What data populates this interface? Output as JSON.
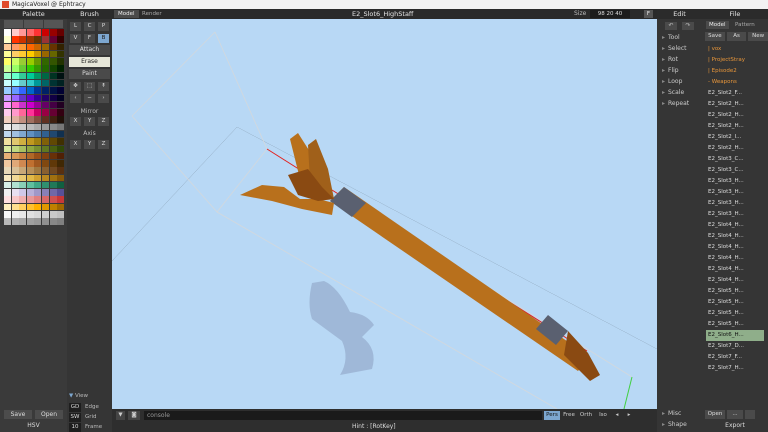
{
  "window": {
    "title": "MagicaVoxel @ Ephtracy"
  },
  "palette": {
    "title": "Palette",
    "tabs": [
      "",
      "",
      ""
    ],
    "colors": [
      "#ffffff",
      "#ffcccc",
      "#ff9999",
      "#ff6666",
      "#ff3333",
      "#cc0000",
      "#990000",
      "#660000",
      "#ffffcc",
      "#ff3300",
      "#cc3300",
      "#993300",
      "#663300",
      "#993333",
      "#660033",
      "#330000",
      "#ffcc99",
      "#ff9966",
      "#ff9933",
      "#ff6600",
      "#cc6600",
      "#996600",
      "#663300",
      "#332200",
      "#ffff99",
      "#ffcc66",
      "#ffcc33",
      "#ffcc00",
      "#cc9900",
      "#996600",
      "#666600",
      "#333300",
      "#ffff66",
      "#ccff66",
      "#99cc33",
      "#99cc00",
      "#669900",
      "#336600",
      "#335500",
      "#223300",
      "#ccff99",
      "#99ff66",
      "#66cc33",
      "#33cc00",
      "#339900",
      "#226600",
      "#114400",
      "#002200",
      "#99ffcc",
      "#66ffcc",
      "#33cc99",
      "#00cc99",
      "#009966",
      "#006644",
      "#003322",
      "#001111",
      "#ccffff",
      "#99ffff",
      "#66cccc",
      "#33cccc",
      "#009999",
      "#006666",
      "#003333",
      "#002222",
      "#99ccff",
      "#6699ff",
      "#3366ff",
      "#0066cc",
      "#003399",
      "#002266",
      "#001144",
      "#000033",
      "#cc99ff",
      "#9966ff",
      "#6633cc",
      "#6600cc",
      "#330099",
      "#220066",
      "#110044",
      "#000022",
      "#ff99ff",
      "#ff66cc",
      "#cc33cc",
      "#cc00cc",
      "#990099",
      "#660066",
      "#440044",
      "#220022",
      "#ffccee",
      "#ff99cc",
      "#ff6699",
      "#ff3399",
      "#cc0066",
      "#990044",
      "#660033",
      "#330011",
      "#f0d0c0",
      "#e0b0a0",
      "#c09080",
      "#a07060",
      "#805040",
      "#603020",
      "#402010",
      "#201008",
      "#eeeeee",
      "#dddddd",
      "#cccccc",
      "#bbbbbb",
      "#aaaaaa",
      "#999999",
      "#888888",
      "#777777",
      "#c0d8f0",
      "#a0c0e0",
      "#80a8d0",
      "#6090c0",
      "#4878a8",
      "#306090",
      "#204870",
      "#103050",
      "#f0e0a0",
      "#e0c870",
      "#d0b040",
      "#c09820",
      "#a08010",
      "#806008",
      "#604804",
      "#403002",
      "#d8e8a0",
      "#c0d880",
      "#a8c060",
      "#90a840",
      "#789030",
      "#607820",
      "#486010",
      "#304808",
      "#e8b078",
      "#d89858",
      "#c88040",
      "#b06828",
      "#985018",
      "#804010",
      "#683008",
      "#502004",
      "#f0c8a0",
      "#e0a878",
      "#d08850",
      "#c07030",
      "#a05820",
      "#804810",
      "#603808",
      "#402804",
      "#e8d8b8",
      "#d8c098",
      "#c8a878",
      "#b89058",
      "#a07840",
      "#886030",
      "#704820",
      "#583010",
      "#f8e8c0",
      "#f0d898",
      "#e8c870",
      "#e0b848",
      "#d0a030",
      "#b88820",
      "#a07010",
      "#885808",
      "#d8f0e8",
      "#b0e0d0",
      "#88d0b8",
      "#60c0a0",
      "#40a888",
      "#309070",
      "#207858",
      "#106040",
      "#f0f0f0",
      "#e8e0f0",
      "#d0c8e8",
      "#b8b0d8",
      "#a098c8",
      "#8880b8",
      "#7068a8",
      "#585098",
      "#ffe0e0",
      "#f8c8c8",
      "#f0b0b0",
      "#e89898",
      "#e08080",
      "#d86868",
      "#d05050",
      "#c83838",
      "#fff0c0",
      "#ffe090",
      "#ffd060",
      "#ffc030",
      "#ffb000",
      "#e09800",
      "#c08000",
      "#a06800",
      "#f8f8f8",
      "#f0f0f0",
      "#e8e8e8",
      "#e0e0e0",
      "#d8d8d8",
      "#d0d0d0",
      "#c8c8c8",
      "#c0c0c0",
      "#b8b8b8",
      "#b0b0b0",
      "#a8a8a8",
      "#a0a0a0",
      "#989898",
      "#909090",
      "#888888",
      "#808080"
    ],
    "save_label": "Save",
    "open_label": "Open",
    "mode_label": "HSV"
  },
  "brush": {
    "title": "Brush",
    "shapes": [
      "L",
      "C",
      "P",
      "V",
      "F",
      "B"
    ],
    "modes": [
      "Attach",
      "Erase",
      "Paint"
    ],
    "tool_icons": [
      "move",
      "select",
      "pin",
      "left",
      "minus",
      "right"
    ],
    "mirror_label": "Mirror",
    "mirror_axes": [
      "X",
      "Y",
      "Z"
    ],
    "axis_label": "Axis",
    "axis_axes": [
      "X",
      "Y",
      "Z"
    ],
    "view_label": "View",
    "rows": [
      {
        "key": "GD",
        "label": "Edge"
      },
      {
        "key": "SW",
        "label": "Grid"
      },
      {
        "key": "10",
        "label": "Frame"
      }
    ]
  },
  "viewport": {
    "tabs": [
      "Model",
      "Render"
    ],
    "title": "E2_Slot6_HighStaff",
    "size_label": "Size",
    "size_value": "98 20 40",
    "right_btn": "F",
    "console_placeholder": "console",
    "view_modes": [
      "Pers",
      "Free",
      "Orth",
      "Iso"
    ],
    "hint": "Hint : [RotKey]",
    "colors": {
      "background": "#b8d8f5",
      "staff_wood": "#b8701c",
      "staff_band": "#5a6070"
    }
  },
  "edit": {
    "title": "Edit",
    "items": [
      "Tool",
      "Select",
      "Rot",
      "Flip",
      "Loop",
      "Scale",
      "Repeat"
    ],
    "bottom_items": [
      "Misc",
      "Shape"
    ]
  },
  "file": {
    "title": "File",
    "tabs": [
      "Model",
      "Pattern"
    ],
    "buttons": [
      "Save",
      "As",
      "New"
    ],
    "folders": [
      "| vox",
      "| ProjectStray",
      "| Episode2",
      "- Weapons"
    ],
    "items": [
      "E2_Slot2_F...",
      "E2_Slot2_H...",
      "E2_Slot2_H...",
      "E2_Slot2_H...",
      "E2_Slot2_I...",
      "E2_Slot2_H...",
      "E2_Slot3_C...",
      "E2_Slot3_C...",
      "E2_Slot3_H...",
      "E2_Slot3_H...",
      "E2_Slot3_H...",
      "E2_Slot3_H...",
      "E2_Slot4_H...",
      "E2_Slot4_H...",
      "E2_Slot4_H...",
      "E2_Slot4_H...",
      "E2_Slot4_H...",
      "E2_Slot4_H...",
      "E2_Slot5_H...",
      "E2_Slot5_H...",
      "E2_Slot5_H...",
      "E2_Slot5_H...",
      "E2_Slot6_H...",
      "E2_Slot7_D...",
      "E2_Slot7_F...",
      "E2_Slot7_H..."
    ],
    "selected_index": 22,
    "open_label": "Open",
    "more_label": "...",
    "export_label": "Export"
  }
}
